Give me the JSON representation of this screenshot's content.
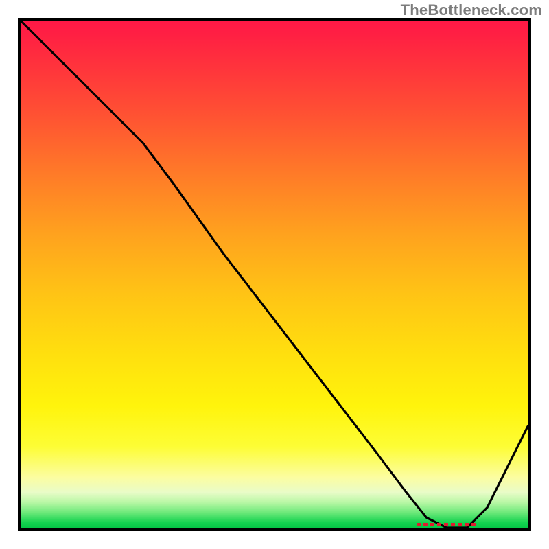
{
  "watermark": "TheBottleneck.com",
  "chart_data": {
    "type": "line",
    "title": "",
    "xlabel": "",
    "ylabel": "",
    "xlim": [
      0,
      100
    ],
    "ylim": [
      0,
      100
    ],
    "grid": false,
    "legend": false,
    "series": [
      {
        "name": "curve",
        "x": [
          0,
          4,
          10,
          18,
          24,
          30,
          40,
          50,
          60,
          70,
          76,
          80,
          84,
          88,
          92,
          96,
          100
        ],
        "y": [
          100,
          96,
          90,
          82,
          76,
          68,
          54,
          41,
          28,
          15,
          7,
          2,
          0,
          0,
          4,
          12,
          20
        ]
      }
    ],
    "annotations": [
      {
        "name": "optimal-range",
        "x_start": 78,
        "x_end": 90,
        "y": 0
      }
    ],
    "colors": {
      "curve": "#000000",
      "optimal_marker": "#e11b2f",
      "gradient_top": "#ff1846",
      "gradient_mid": "#ffe00e",
      "gradient_bottom": "#06c646"
    }
  }
}
